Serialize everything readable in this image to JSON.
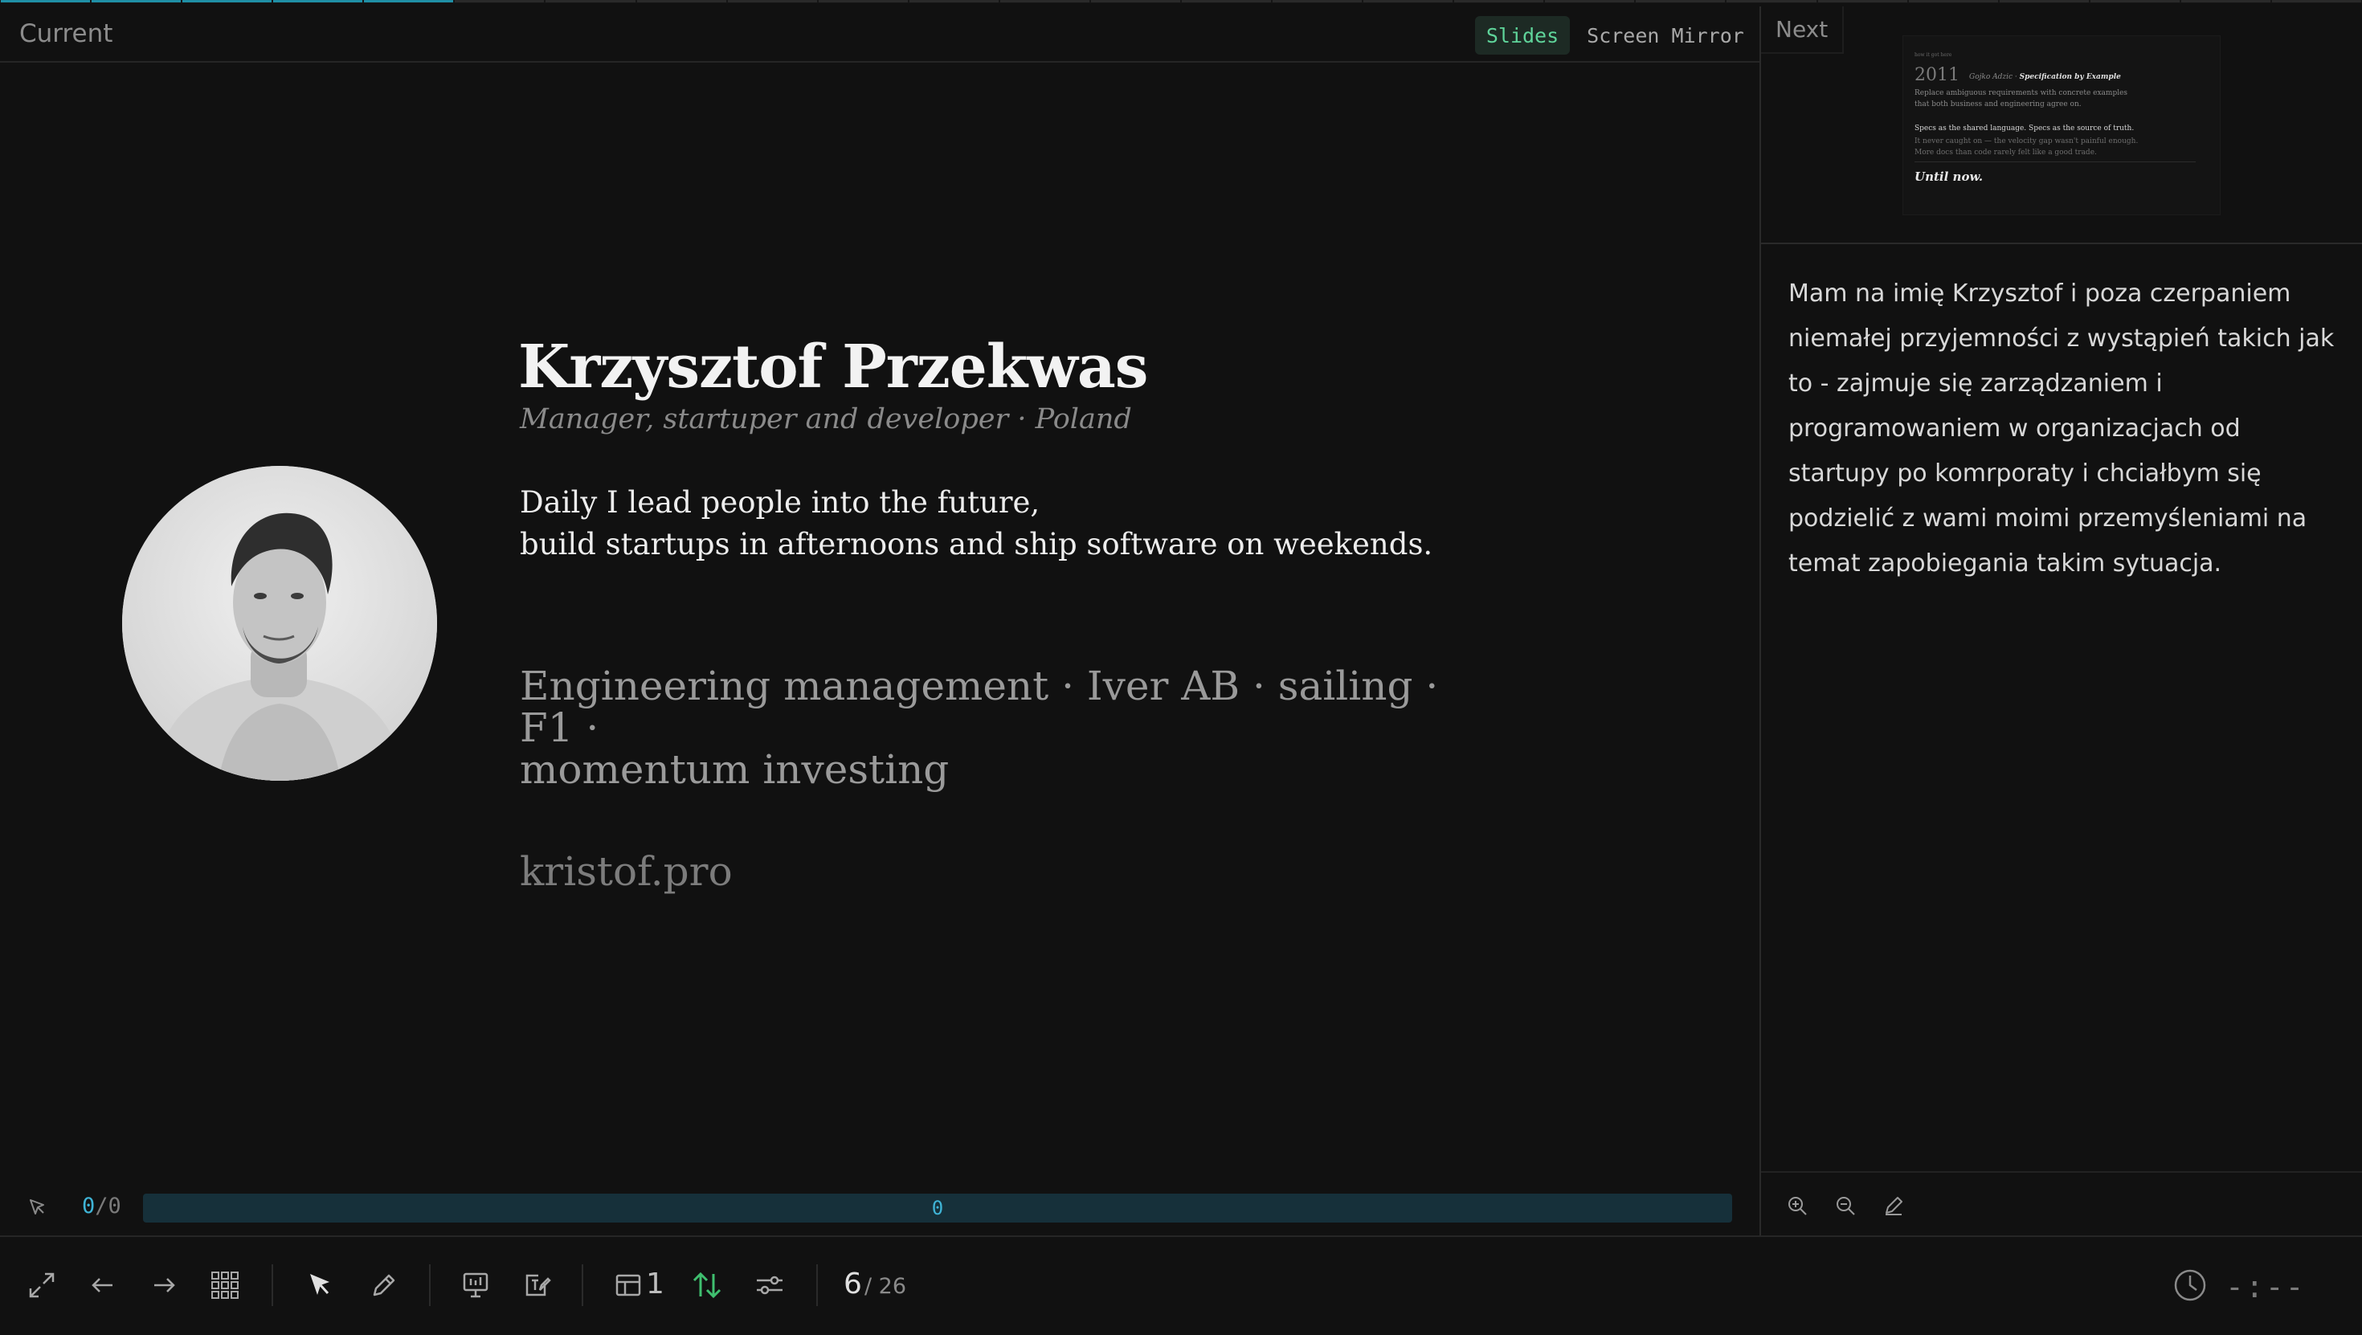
{
  "top_progress": {
    "current_slide": 6,
    "total_slides": 26
  },
  "header": {
    "current_label": "Current",
    "modes": {
      "slides": "Slides",
      "mirror": "Screen Mirror"
    },
    "active_mode": "Slides"
  },
  "slide": {
    "name": "Krzysztof Przekwas",
    "subtitle": "Manager, startuper and developer · Poland",
    "tagline_line1": "Daily I lead people into the future,",
    "tagline_line2": "build startups in afternoons and ship software on weekends.",
    "interests_line1": "Engineering management · Iver AB · sailing · F1 ·",
    "interests_line2": "momentum investing",
    "url": "kristof.pro",
    "photo_icon": "portrait-photo"
  },
  "clicks": {
    "current": "0",
    "separator": "/",
    "total": "0",
    "track_label": "0"
  },
  "next": {
    "label": "Next",
    "thumb_tiny": "how it got here",
    "thumb_year": "2011",
    "thumb_author": "Gojko Adzic · ",
    "thumb_book": "Specification by Example",
    "thumb_line1": "Replace ambiguous requirements with concrete examples",
    "thumb_line2": "that both business and engineering agree on.",
    "thumb_line3": "Specs as the shared language. Specs as the source of truth.",
    "thumb_line4": "It never caught on — the velocity gap wasn't painful enough.",
    "thumb_line5": "More docs than code rarely felt like a good trade.",
    "thumb_until": "Until now."
  },
  "notes": {
    "text": "Mam na imię Krzysztof i poza czerpaniem niemałej przyjemności z wystąpień takich jak to - zajmuje się zarządzaniem i programowaniem w organizacjach od startupy po komrporaty i chciałbym się podzielić z wami moimi przemyśleniami na temat zapobiegania takim sytuacja."
  },
  "toolbar": {
    "layout_number": "1",
    "page_current": "6",
    "page_total": "/ 26",
    "timer": "-:--"
  },
  "colors": {
    "accent": "#3fb4d6",
    "active_mode": "#5fd49a",
    "green_arrows": "#3fbf6f",
    "background": "#111111"
  }
}
